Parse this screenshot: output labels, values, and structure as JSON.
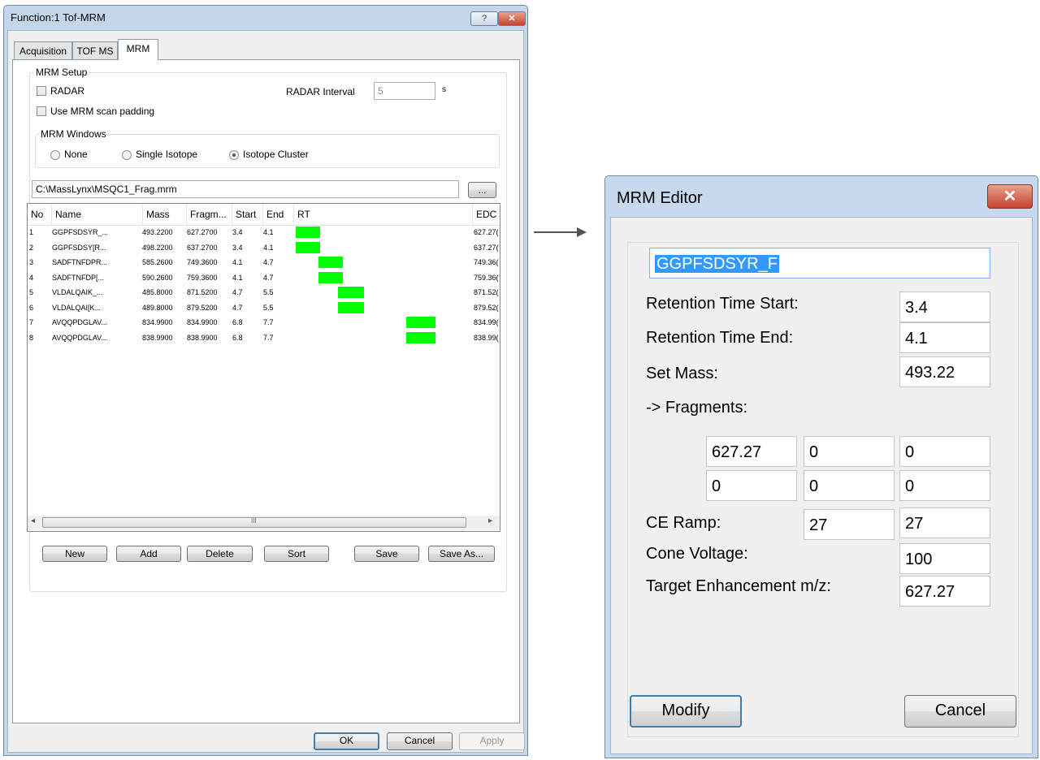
{
  "left_dialog": {
    "title": "Function:1 Tof-MRM",
    "help_label": "?",
    "close_label": "✕",
    "tabs": [
      {
        "label": "Acquisition"
      },
      {
        "label": "TOF MS"
      },
      {
        "label": "MRM"
      }
    ],
    "mrm_setup": {
      "group_label": "MRM Setup",
      "radar_label": "RADAR",
      "radar_checked": false,
      "padding_label": "Use MRM scan padding",
      "padding_checked": false,
      "radar_interval_label": "RADAR Interval",
      "radar_interval_value": "5",
      "radar_interval_unit": "s",
      "windows_group_label": "MRM Windows",
      "windows_options": [
        {
          "label": "None",
          "selected": false
        },
        {
          "label": "Single Isotope",
          "selected": false
        },
        {
          "label": "Isotope Cluster",
          "selected": true
        }
      ]
    },
    "file_path": "C:\\MassLynx\\MSQC1_Frag.mrm",
    "browse_label": "...",
    "list": {
      "headers": [
        "No",
        "Name",
        "Mass",
        "Fragm...",
        "Start",
        "End",
        "RT",
        "EDC"
      ],
      "rows": [
        {
          "no": "1",
          "name": "GGPFSDSYR_...",
          "mass": "493.2200",
          "frag": "627.2700",
          "start": "3.4",
          "end": "4.1",
          "edc": "627.27("
        },
        {
          "no": "2",
          "name": "GGPFSDSY[R...",
          "mass": "498.2200",
          "frag": "637.2700",
          "start": "3.4",
          "end": "4.1",
          "edc": "637.27("
        },
        {
          "no": "3",
          "name": "SADFTNFDPR...",
          "mass": "585.2600",
          "frag": "749.3600",
          "start": "4.1",
          "end": "4.7",
          "edc": "749.36("
        },
        {
          "no": "4",
          "name": "SADFTNFDP[...",
          "mass": "590.2600",
          "frag": "759.3600",
          "start": "4.1",
          "end": "4.7",
          "edc": "759.36("
        },
        {
          "no": "5",
          "name": "VLDALQAIK_...",
          "mass": "485.8000",
          "frag": "871.5200",
          "start": "4.7",
          "end": "5.5",
          "edc": "871.52("
        },
        {
          "no": "6",
          "name": "VLDALQAI[K...",
          "mass": "489.8000",
          "frag": "879.5200",
          "start": "4.7",
          "end": "5.5",
          "edc": "879.52("
        },
        {
          "no": "7",
          "name": "AVQQPDGLAV...",
          "mass": "834.9900",
          "frag": "834.9900",
          "start": "6.8",
          "end": "7.7",
          "edc": "834.99("
        },
        {
          "no": "8",
          "name": "AVQQPDGLAV...",
          "mass": "838.9900",
          "frag": "838.9900",
          "start": "6.8",
          "end": "7.7",
          "edc": "838.99("
        }
      ],
      "scroll_left": "◂",
      "scroll_right": "▸",
      "scroll_grip": "III"
    },
    "list_buttons": {
      "new": "New",
      "add": "Add",
      "delete": "Delete",
      "sort": "Sort",
      "save": "Save",
      "save_as": "Save As..."
    },
    "footer_buttons": {
      "ok": "OK",
      "cancel": "Cancel",
      "apply": "Apply"
    }
  },
  "right_dialog": {
    "title": "MRM Editor",
    "close_label": "✕",
    "name_value": "GGPFSDSYR_F",
    "rt_start_label": "Retention Time Start:",
    "rt_start_value": "3.4",
    "rt_end_label": "Retention Time End:",
    "rt_end_value": "4.1",
    "set_mass_label": "Set Mass:",
    "set_mass_value": "493.22",
    "fragments_label": "-> Fragments:",
    "fragments": [
      "627.27",
      "0",
      "0",
      "0",
      "0",
      "0"
    ],
    "ce_ramp_label": "CE Ramp:",
    "ce_ramp_values": [
      "27",
      "27"
    ],
    "cone_voltage_label": "Cone Voltage:",
    "cone_voltage_value": "100",
    "target_label": "Target Enhancement m/z:",
    "target_value": "627.27",
    "modify_label": "Modify",
    "cancel_label": "Cancel"
  },
  "colors": {
    "rt_bar": "#00ff00",
    "selection": "#3399ff",
    "close_button": "#c9432c"
  }
}
